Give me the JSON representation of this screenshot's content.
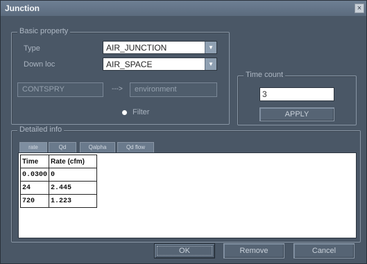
{
  "window": {
    "title": "Junction",
    "close_glyph": "×"
  },
  "basic_property": {
    "legend": "Basic property",
    "type_label": "Type",
    "type_value": "AIR_JUNCTION",
    "down_label": "Down loc",
    "down_value": "AIR_SPACE",
    "from_value": "CONTSPRY",
    "arrow_text": "--->",
    "to_value": "environment",
    "filter_label": "Filter"
  },
  "time_count": {
    "legend": "Time count",
    "value": "3",
    "apply_label": "APPLY"
  },
  "detailed_info": {
    "legend": "Detailed info",
    "tabs": [
      "rate",
      "Qd",
      "Qalpha",
      "Qd flow"
    ],
    "table": {
      "headers": [
        "Time",
        "Rate (cfm)"
      ],
      "rows": [
        [
          "0.0300",
          "0"
        ],
        [
          "24",
          "2.445"
        ],
        [
          "720",
          "1.223"
        ]
      ]
    }
  },
  "footer": {
    "ok_label": "OK",
    "remove_label": "Remove",
    "cancel_label": "Cancel"
  }
}
